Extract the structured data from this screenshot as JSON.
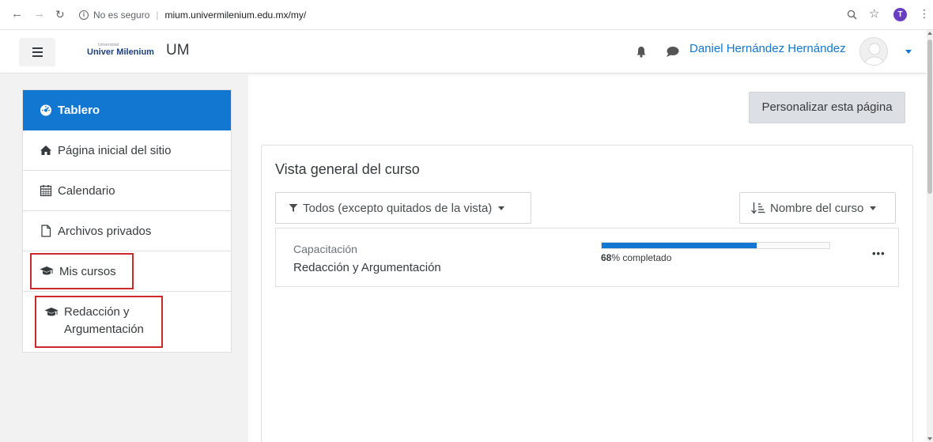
{
  "browser": {
    "security_text": "No es seguro",
    "url": "mium.univermilenium.edu.mx/my/",
    "profile_initial": "T"
  },
  "navbar": {
    "logo_small": "Universidad",
    "logo_big": "Univer Milenium",
    "site_name": "UM",
    "user_name": "Daniel Hernández Hernández"
  },
  "drawer": {
    "items": [
      {
        "label": "Tablero",
        "icon": "dashboard-icon",
        "active": true
      },
      {
        "label": "Página inicial del sitio",
        "icon": "home-icon"
      },
      {
        "label": "Calendario",
        "icon": "calendar-icon"
      },
      {
        "label": "Archivos privados",
        "icon": "file-icon"
      },
      {
        "label": "Mis cursos",
        "icon": "graduation-cap-icon"
      },
      {
        "label": "Redacción y Argumentación",
        "icon": "graduation-cap-icon"
      }
    ]
  },
  "main": {
    "customize_label": "Personalizar esta página",
    "overview_title": "Vista general del curso",
    "filter_label": "Todos (excepto quitados de la vista)",
    "sort_label": "Nombre del curso",
    "courses": [
      {
        "category": "Capacitación",
        "name": "Redacción y Argumentación",
        "progress_percent": 68,
        "progress_value": "68",
        "progress_suffix": "% completado"
      }
    ]
  },
  "colors": {
    "accent": "#1177d1",
    "highlight_box": "#cc2a2a"
  }
}
